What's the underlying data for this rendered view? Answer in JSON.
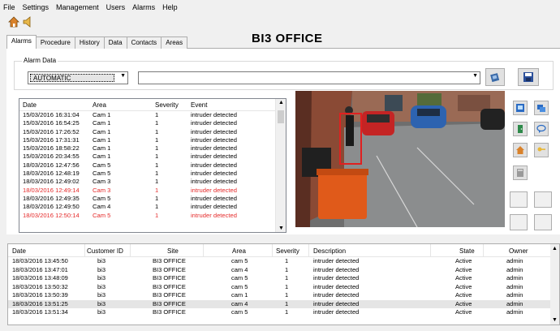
{
  "menu": [
    "File",
    "Settings",
    "Management",
    "Users",
    "Alarms",
    "Help"
  ],
  "toolbar": {
    "icons": [
      "home-icon",
      "speaker-icon"
    ]
  },
  "tabs": [
    "Alarms",
    "Procedure",
    "History",
    "Data",
    "Contacts",
    "Areas"
  ],
  "active_tab": "Alarms",
  "page_title": "BI3 OFFICE",
  "alarm_data": {
    "group_label": "Alarm Data",
    "mode_value": "AUTOMATIC",
    "second_value": ""
  },
  "events_table": {
    "headers": [
      "Date",
      "Area",
      "Severity",
      "Event"
    ],
    "rows": [
      [
        "15/03/2016 16:31:04",
        "Cam 1",
        "1",
        "intruder detected",
        false
      ],
      [
        "15/03/2016 16:54:25",
        "Cam 1",
        "1",
        "intruder detected",
        false
      ],
      [
        "15/03/2016 17:26:52",
        "Cam 1",
        "1",
        "intruder detected",
        false
      ],
      [
        "15/03/2016 17:31:31",
        "Cam 1",
        "1",
        "intruder detected",
        false
      ],
      [
        "15/03/2016 18:58:22",
        "Cam 1",
        "1",
        "intruder detected",
        false
      ],
      [
        "15/03/2016 20:34:55",
        "Cam 1",
        "1",
        "intruder detected",
        false
      ],
      [
        "18/03/2016 12:47:56",
        "Cam 5",
        "1",
        "intruder detected",
        false
      ],
      [
        "18/03/2016 12:48:19",
        "Cam 5",
        "1",
        "intruder detected",
        false
      ],
      [
        "18/03/2016 12:49:02",
        "Cam 3",
        "1",
        "intruder detected",
        false
      ],
      [
        "18/03/2016 12:49:14",
        "Cam 3",
        "1",
        "intruder detected",
        true
      ],
      [
        "18/03/2016 12:49:35",
        "Cam 5",
        "1",
        "intruder detected",
        false
      ],
      [
        "18/03/2016 12:49:50",
        "Cam 4",
        "1",
        "intruder detected",
        false
      ],
      [
        "18/03/2016 12:50:14",
        "Cam 5",
        "1",
        "intruder detected",
        true
      ]
    ]
  },
  "history_table": {
    "headers": [
      "Date",
      "Customer ID",
      "Site",
      "Area",
      "Severity",
      "Description",
      "State",
      "Owner"
    ],
    "rows": [
      [
        "18/03/2016 13:45:50",
        "bi3",
        "BI3 OFFICE",
        "cam 5",
        "1",
        "intruder detected",
        "Active",
        "admin"
      ],
      [
        "18/03/2016 13:47:01",
        "bi3",
        "BI3 OFFICE",
        "cam 4",
        "1",
        "intruder detected",
        "Active",
        "admin"
      ],
      [
        "18/03/2016 13:48:09",
        "bi3",
        "BI3 OFFICE",
        "cam 5",
        "1",
        "intruder detected",
        "Active",
        "admin"
      ],
      [
        "18/03/2016 13:50:32",
        "bi3",
        "BI3 OFFICE",
        "cam 5",
        "1",
        "intruder detected",
        "Active",
        "admin"
      ],
      [
        "18/03/2016 13:50:39",
        "bi3",
        "BI3 OFFICE",
        "cam 1",
        "1",
        "intruder detected",
        "Active",
        "admin"
      ],
      [
        "18/03/2016 13:51:25",
        "bi3",
        "BI3 OFFICE",
        "cam 4",
        "1",
        "intruder detected",
        "Active",
        "admin"
      ],
      [
        "18/03/2016 13:51:34",
        "bi3",
        "BI3 OFFICE",
        "cam 5",
        "1",
        "intruder detected",
        "Active",
        "admin"
      ]
    ],
    "selected_row": 5
  },
  "colors": {
    "alert_red": "#e52b2b",
    "selection": "#e5e5e5",
    "detection_box": "#e02020"
  }
}
